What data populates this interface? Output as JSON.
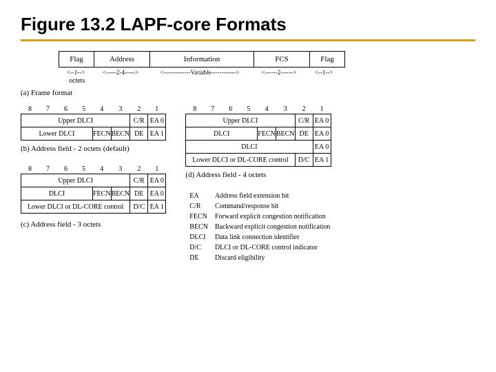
{
  "title": "Figure 13.2 LAPF-core Formats",
  "frame": {
    "cells": {
      "flag": "Flag",
      "address": "Address",
      "information": "Information",
      "fcs": "FCS",
      "flag2": "Flag"
    },
    "spans": {
      "flag": "<--1-->",
      "address": "<-----2-4----->",
      "information": "<-------------Variable------------>",
      "fcs": "<------2------>",
      "flag2": "<--1-->"
    },
    "octets": "octets",
    "caption": "(a) Frame format"
  },
  "bits": {
    "b8": "8",
    "b7": "7",
    "b6": "6",
    "b5": "5",
    "b4": "4",
    "b3": "3",
    "b2": "2",
    "b1": "1"
  },
  "common": {
    "upper_dlci": "Upper DLCI",
    "cr": "C/R",
    "ea0": "EA 0",
    "ea1": "EA 1",
    "fecn": "FECN",
    "becn": "BECN",
    "de": "DE",
    "dlci": "DLCI",
    "lower_dlci": "Lower DLCI",
    "dc": "D/C",
    "lower_or_core": "Lower DLCI or DL-CORE control"
  },
  "captions": {
    "b": "(b) Address field - 2 octets (default)",
    "c": "(c) Address field - 3 octets",
    "d": "(d) Address field - 4 octets"
  },
  "legend": {
    "EA": "Address field extension bit",
    "CR": "Command/response bit",
    "FECN_k": "FECN",
    "FECN": "Forward explicit congestion notification",
    "BECN_k": "BECN",
    "BECN": "Backward explicit congestion notification",
    "DLCI_k": "DLCI",
    "DLCI": "Data link connection identifier",
    "DC_k": "D/C",
    "DC": "DLCI or DL-CORE control indicator",
    "DE_k": "DE",
    "DE": "Discard eligibility",
    "EA_k": "EA",
    "CR_k": "C/R"
  }
}
